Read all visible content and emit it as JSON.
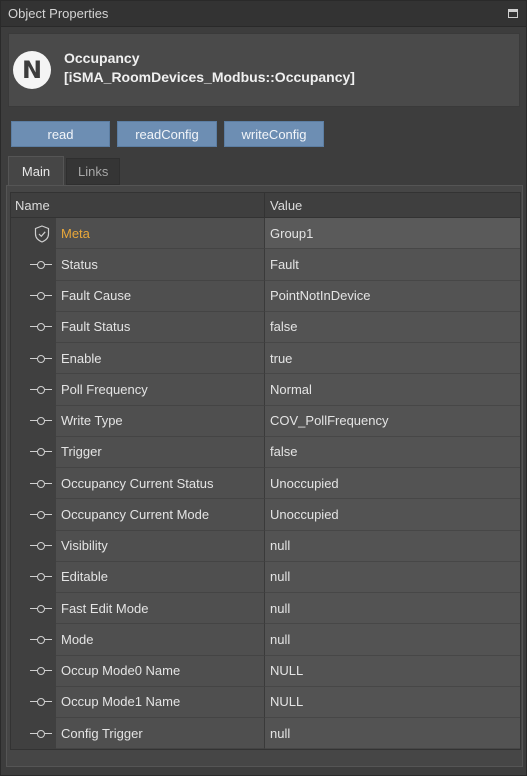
{
  "window": {
    "title": "Object Properties"
  },
  "object": {
    "logo_letter": "N",
    "name": "Occupancy",
    "type": "[iSMA_RoomDevices_Modbus::Occupancy]"
  },
  "actions": {
    "read": "read",
    "read_config": "readConfig",
    "write_config": "writeConfig"
  },
  "tabs": {
    "main": "Main",
    "links": "Links"
  },
  "table": {
    "columns": {
      "name": "Name",
      "value": "Value"
    },
    "rows": [
      {
        "name": "Meta",
        "value": "Group1"
      },
      {
        "name": "Status",
        "value": "Fault"
      },
      {
        "name": "Fault Cause",
        "value": "PointNotInDevice"
      },
      {
        "name": "Fault Status",
        "value": "false"
      },
      {
        "name": "Enable",
        "value": "true"
      },
      {
        "name": "Poll Frequency",
        "value": "Normal"
      },
      {
        "name": "Write Type",
        "value": "COV_PollFrequency"
      },
      {
        "name": "Trigger",
        "value": "false"
      },
      {
        "name": "Occupancy Current Status",
        "value": "Unoccupied"
      },
      {
        "name": "Occupancy Current Mode",
        "value": "Unoccupied"
      },
      {
        "name": "Visibility",
        "value": "null"
      },
      {
        "name": "Editable",
        "value": "null"
      },
      {
        "name": "Fast Edit Mode",
        "value": "null"
      },
      {
        "name": "Mode",
        "value": "null"
      },
      {
        "name": "Occup Mode0 Name",
        "value": "NULL"
      },
      {
        "name": "Occup Mode1 Name",
        "value": "NULL"
      },
      {
        "name": "Config Trigger",
        "value": "null"
      }
    ]
  },
  "colors": {
    "accent_button": "#6d8eb3",
    "meta_label": "#e8a73a"
  }
}
